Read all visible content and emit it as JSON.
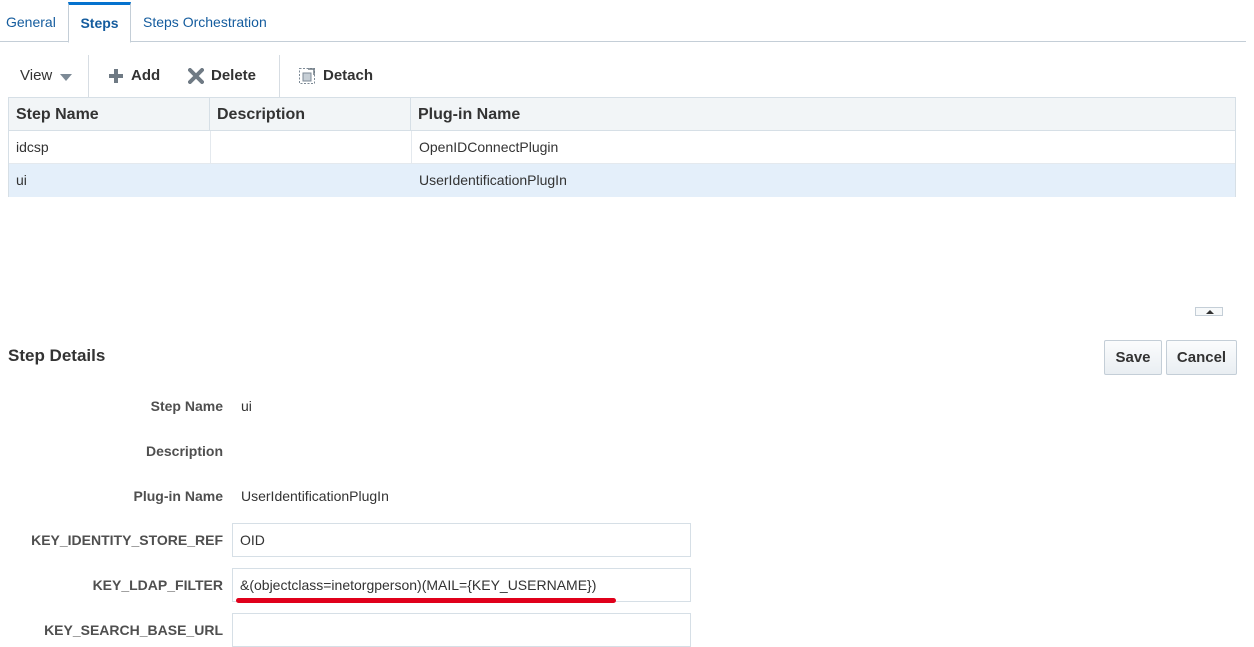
{
  "tabs": {
    "general": "General",
    "steps": "Steps",
    "orchestration": "Steps Orchestration"
  },
  "toolbar": {
    "view_label": "View",
    "add_label": "Add",
    "delete_label": "Delete",
    "detach_label": "Detach"
  },
  "table": {
    "headers": {
      "step_name": "Step Name",
      "description": "Description",
      "plugin_name": "Plug-in Name"
    },
    "rows": [
      {
        "step_name": "idcsp",
        "description": "",
        "plugin_name": "OpenIDConnectPlugin",
        "selected": false
      },
      {
        "step_name": "ui",
        "description": "",
        "plugin_name": "UserIdentificationPlugIn",
        "selected": true
      }
    ]
  },
  "details": {
    "title": "Step Details",
    "save_label": "Save",
    "cancel_label": "Cancel",
    "fields": {
      "step_name": {
        "label": "Step Name",
        "value": "ui"
      },
      "description": {
        "label": "Description",
        "value": ""
      },
      "plugin_name": {
        "label": "Plug-in Name",
        "value": "UserIdentificationPlugIn"
      },
      "identity_store_ref": {
        "label": "KEY_IDENTITY_STORE_REF",
        "value": "OID"
      },
      "ldap_filter": {
        "label": "KEY_LDAP_FILTER",
        "value": "&(objectclass=inetorgperson)(MAIL={KEY_USERNAME})"
      },
      "search_base_url": {
        "label": "KEY_SEARCH_BASE_URL",
        "value": ""
      }
    }
  },
  "colors": {
    "accent": "#0572ce",
    "link": "#145c9e",
    "selected_row": "#e4effa",
    "highlight_underline": "#e0001b"
  }
}
